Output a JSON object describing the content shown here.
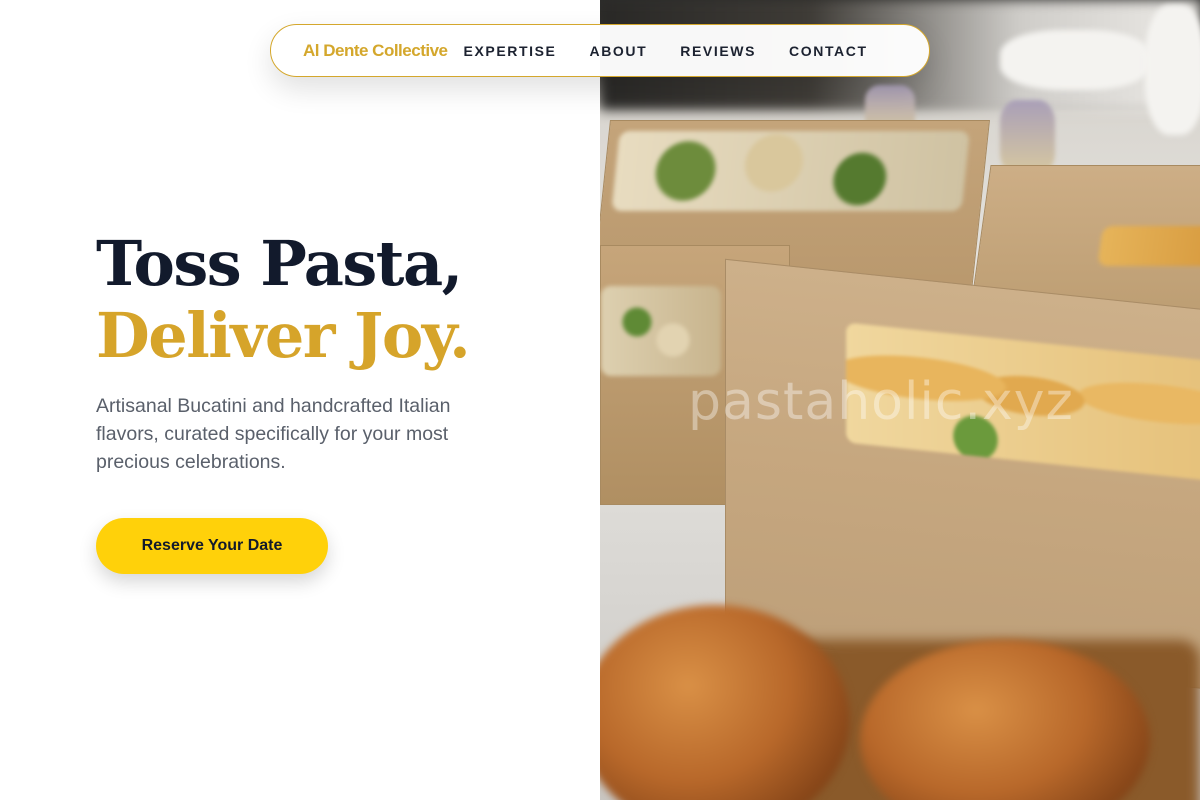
{
  "nav": {
    "brand": "Al Dente Collective",
    "links": [
      {
        "label": "EXPERTISE"
      },
      {
        "label": "ABOUT"
      },
      {
        "label": "REVIEWS"
      },
      {
        "label": "CONTACT"
      }
    ]
  },
  "hero": {
    "headline_line_1": "Toss Pasta,",
    "headline_line_2": "Deliver Joy.",
    "tagline": "Artisanal Bucatini and handcrafted Italian flavors, curated specifically for your most precious celebrations.",
    "cta_label": "Reserve Your Date"
  },
  "photo": {
    "watermark": "pastaholic.xyz",
    "subject": "catering boxes with focaccia, salads and croissants"
  },
  "colors": {
    "accent_gold": "#d4a72c",
    "cta_yellow": "#ffd10a",
    "heading_navy": "#121a2c",
    "body_gray": "#5a606b"
  }
}
